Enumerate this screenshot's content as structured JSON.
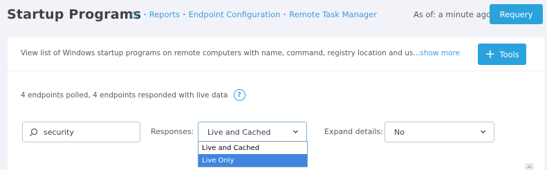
{
  "header": {
    "title": "Startup Programs",
    "breadcrumb": [
      "Reports",
      "Endpoint Configuration",
      "Remote Task Manager"
    ],
    "as_of": "As of: a minute ago",
    "requery_label": "Requery"
  },
  "panel": {
    "description": "View list of Windows startup programs on remote computers with name, command, registry location and us...",
    "show_more": "show more",
    "tools_label": "Tools",
    "polled_text": "4 endpoints polled, 4 endpoints responded with live data",
    "help_glyph": "?"
  },
  "filters": {
    "search_value": "security",
    "responses_label": "Responses:",
    "responses_selected": "Live and Cached",
    "responses_options": [
      "Live and Cached",
      "Live Only"
    ],
    "responses_highlighted": "Live Only",
    "expand_label": "Expand details:",
    "expand_selected": "No"
  },
  "icons": {
    "home": "home-icon",
    "search": "search-icon",
    "plus": "plus-icon",
    "help": "help-circle-icon",
    "chevron": "chevron-down-icon"
  },
  "colors": {
    "accent": "#2aa3dd",
    "link": "#3d9be0",
    "dropdown_highlight": "#3f86e0",
    "background": "#f2f3f8"
  }
}
